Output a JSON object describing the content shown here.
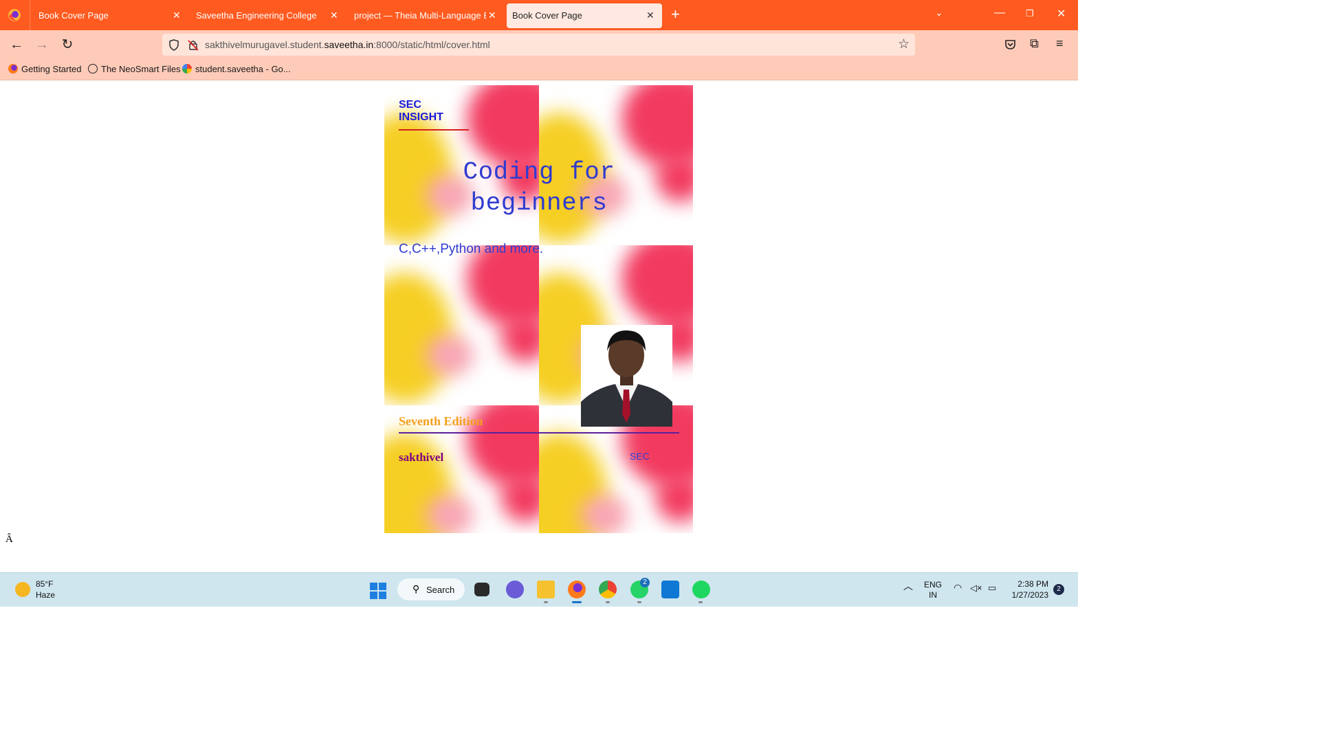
{
  "browser": {
    "tabs": [
      {
        "label": "Book Cover Page",
        "active": false
      },
      {
        "label": "Saveetha Engineering College",
        "active": false
      },
      {
        "label": "project — Theia Multi-Language Ex",
        "active": false
      },
      {
        "label": "Book Cover Page",
        "active": true
      }
    ],
    "url": {
      "prefix": "sakthivelmurugavel.student.",
      "domain": "saveetha.in",
      "suffix": ":8000/static/html/cover.html"
    },
    "bookmarks": [
      {
        "label": "Getting Started",
        "icon": "firefox-icon"
      },
      {
        "label": "The NeoSmart Files",
        "icon": "globe-icon"
      },
      {
        "label": "student.saveetha - Go...",
        "icon": "google-icon"
      }
    ]
  },
  "cover": {
    "series_label": "SEC INSIGHT",
    "title_line1": "Coding for",
    "title_line2": "beginners",
    "subtitle": "C,C++,Python and more.",
    "edition": "Seventh Edition",
    "author": "sakthivel",
    "publisher": "SEC",
    "stray_char": "Â"
  },
  "taskbar": {
    "weather_temp": "85°F",
    "weather_desc": "Haze",
    "search_label": "Search",
    "whatsapp_badge": "2",
    "lang_line1": "ENG",
    "lang_line2": "IN",
    "time": "2:38 PM",
    "date": "1/27/2023",
    "notification_count": "2"
  },
  "colors": {
    "tabbar": "#ff5a1f",
    "toolbar": "#ffcbb9",
    "title_blue": "#2f3bd0",
    "edition_orange": "#f4a020",
    "author_purple": "#800080"
  }
}
